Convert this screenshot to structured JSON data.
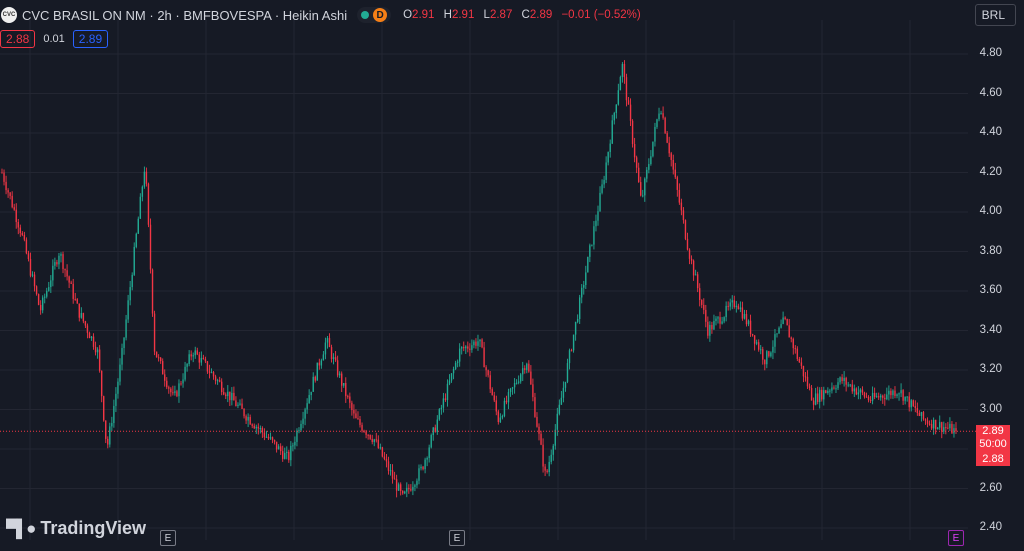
{
  "header": {
    "logo_text": "CVC",
    "title": "CVC BRASIL ON NM · 2h · BMFBOVESPA · Heikin Ashi",
    "status_badge": "D",
    "ohlc": {
      "o_label": "O",
      "o_value": "2.91",
      "h_label": "H",
      "h_value": "2.91",
      "l_label": "L",
      "l_value": "2.87",
      "c_label": "C",
      "c_value": "2.89",
      "change": "−0.01 (−0.52%)"
    }
  },
  "quote": {
    "bid": "2.88",
    "spread": "0.01",
    "ask": "2.89"
  },
  "currency": "BRL",
  "price_tag": {
    "price": "2.89",
    "countdown": "50:00",
    "bid": "2.88"
  },
  "branding": "TradingView",
  "events": [
    "E",
    "E",
    "E"
  ],
  "colors": {
    "up": "#22ab94",
    "down": "#f23645",
    "background": "#161a25",
    "grid": "#232632",
    "accent": "#2962ff"
  },
  "chart_data": {
    "type": "candlestick",
    "style": "Heikin Ashi",
    "y_ticks": [
      "4.80",
      "4.60",
      "4.40",
      "4.20",
      "4.00",
      "3.80",
      "3.60",
      "3.40",
      "3.20",
      "3.00",
      "2.80",
      "2.60",
      "2.40"
    ],
    "ylim": [
      2.4,
      4.8
    ],
    "last_price": 2.89,
    "close_path": [
      [
        0,
        4.2
      ],
      [
        0.02,
        3.9
      ],
      [
        0.04,
        3.5
      ],
      [
        0.06,
        3.8
      ],
      [
        0.08,
        3.5
      ],
      [
        0.1,
        3.3
      ],
      [
        0.11,
        2.8
      ],
      [
        0.125,
        3.25
      ],
      [
        0.15,
        4.25
      ],
      [
        0.16,
        3.3
      ],
      [
        0.18,
        3.05
      ],
      [
        0.2,
        3.3
      ],
      [
        0.25,
        3.0
      ],
      [
        0.3,
        2.75
      ],
      [
        0.34,
        3.35
      ],
      [
        0.37,
        2.95
      ],
      [
        0.39,
        2.85
      ],
      [
        0.42,
        2.55
      ],
      [
        0.44,
        2.7
      ],
      [
        0.46,
        3.0
      ],
      [
        0.48,
        3.3
      ],
      [
        0.5,
        3.35
      ],
      [
        0.52,
        2.95
      ],
      [
        0.55,
        3.25
      ],
      [
        0.57,
        2.65
      ],
      [
        0.61,
        3.65
      ],
      [
        0.63,
        4.15
      ],
      [
        0.65,
        4.75
      ],
      [
        0.67,
        4.05
      ],
      [
        0.69,
        4.55
      ],
      [
        0.72,
        3.8
      ],
      [
        0.74,
        3.4
      ],
      [
        0.77,
        3.55
      ],
      [
        0.8,
        3.25
      ],
      [
        0.82,
        3.45
      ],
      [
        0.85,
        3.05
      ],
      [
        0.88,
        3.15
      ],
      [
        0.91,
        3.05
      ],
      [
        0.94,
        3.1
      ],
      [
        0.965,
        2.95
      ],
      [
        1.0,
        2.89
      ]
    ]
  }
}
